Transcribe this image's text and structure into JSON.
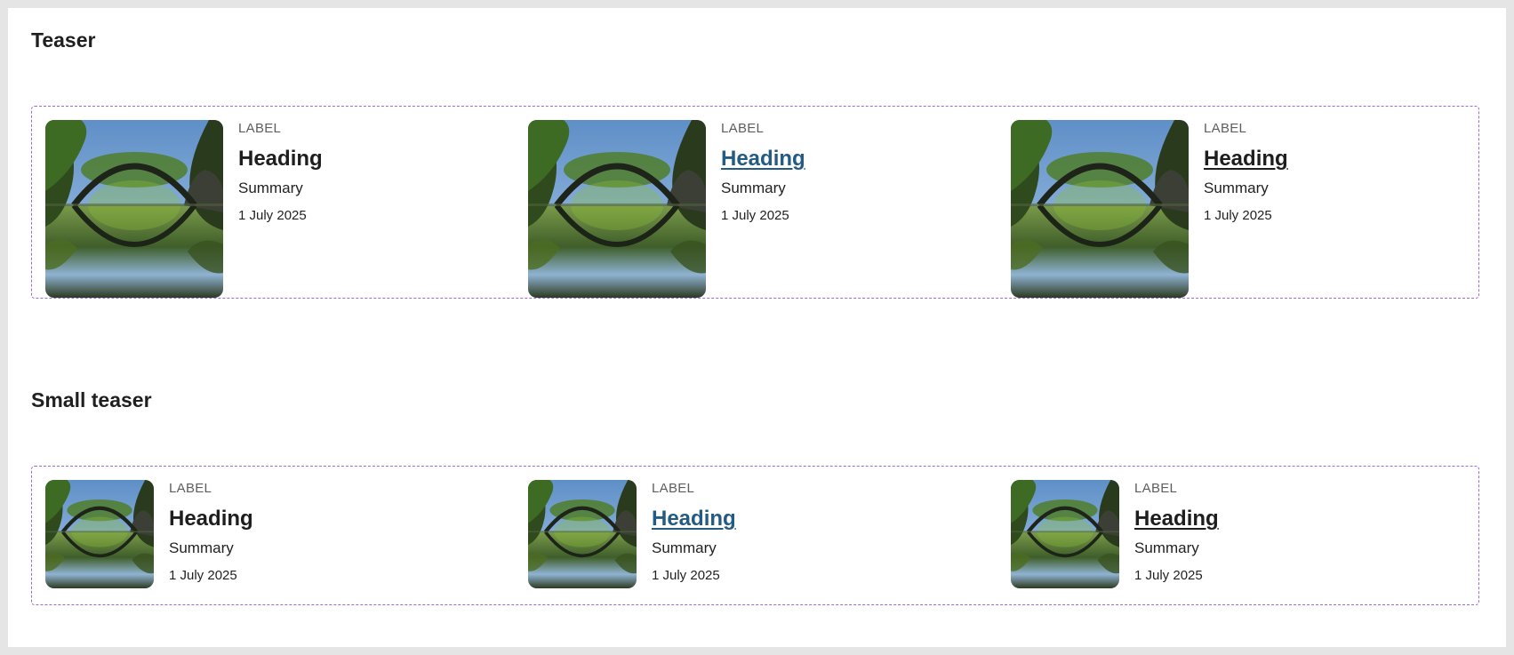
{
  "sections": [
    {
      "title": "Teaser",
      "cards": [
        {
          "label": "LABEL",
          "heading": "Heading",
          "summary": "Summary",
          "date": "1 July 2025"
        },
        {
          "label": "LABEL",
          "heading": "Heading",
          "summary": "Summary",
          "date": "1 July 2025"
        },
        {
          "label": "LABEL",
          "heading": "Heading",
          "summary": "Summary",
          "date": "1 July 2025"
        }
      ]
    },
    {
      "title": "Small teaser",
      "cards": [
        {
          "label": "LABEL",
          "heading": "Heading",
          "summary": "Summary",
          "date": "1 July 2025"
        },
        {
          "label": "LABEL",
          "heading": "Heading",
          "summary": "Summary",
          "date": "1 July 2025"
        },
        {
          "label": "LABEL",
          "heading": "Heading",
          "summary": "Summary",
          "date": "1 July 2025"
        }
      ]
    }
  ],
  "colors": {
    "frame_border": "#9a6ad6",
    "link_hover": "#245b82",
    "page_bg": "#e5e5e5"
  }
}
